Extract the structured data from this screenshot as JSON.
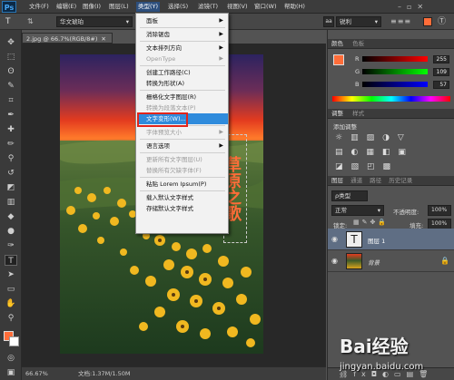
{
  "app": {
    "logo": "Ps"
  },
  "menubar": {
    "items": [
      "文件(F)",
      "编辑(E)",
      "图像(I)",
      "图层(L)",
      "类型(Y)",
      "选择(S)",
      "滤镜(T)",
      "视图(V)",
      "窗口(W)",
      "帮助(H)"
    ],
    "active_index": 4
  },
  "options": {
    "font_family": "华文琥珀",
    "aa": "锐利",
    "aa_prefix": "aa"
  },
  "document": {
    "tab": "2.jpg @ 66.7%(RGB/8#)",
    "zoom": "66.67%",
    "doc_info": "文档:1.37M/1.50M"
  },
  "canvas_text": "草原之歌",
  "type_menu": {
    "items": [
      {
        "label": "面板",
        "submenu": true,
        "enabled": true
      },
      {
        "sep": true
      },
      {
        "label": "消除锯齿",
        "submenu": true,
        "enabled": true
      },
      {
        "sep": true
      },
      {
        "label": "文本排列方向",
        "submenu": true,
        "enabled": true
      },
      {
        "label": "OpenType",
        "submenu": true,
        "enabled": false
      },
      {
        "sep": true
      },
      {
        "label": "创建工作路径(C)",
        "enabled": true
      },
      {
        "label": "转换为形状(A)",
        "enabled": true
      },
      {
        "sep": true
      },
      {
        "label": "栅格化文字图层(R)",
        "enabled": true
      },
      {
        "label": "转换为段落文本(P)",
        "enabled": false
      },
      {
        "label": "文字变形(W)...",
        "enabled": true,
        "highlighted": true
      },
      {
        "sep": true
      },
      {
        "label": "字体预览大小",
        "submenu": true,
        "enabled": false
      },
      {
        "sep": true
      },
      {
        "label": "语言选项",
        "submenu": true,
        "enabled": true
      },
      {
        "sep": true
      },
      {
        "label": "更新所有文字图层(U)",
        "enabled": false
      },
      {
        "label": "替换所有欠缺字体(F)",
        "enabled": false
      },
      {
        "sep": true
      },
      {
        "label": "粘贴 Lorem Ipsum(P)",
        "enabled": true
      },
      {
        "sep": true
      },
      {
        "label": "载入默认文字样式",
        "enabled": true
      },
      {
        "label": "存储默认文字样式",
        "enabled": true
      }
    ]
  },
  "color_panel": {
    "tabs": [
      "颜色",
      "色板"
    ],
    "channels": [
      {
        "name": "R",
        "value": "255",
        "color": "#ff0000"
      },
      {
        "name": "G",
        "value": "109",
        "color": "#00ff00"
      },
      {
        "name": "B",
        "value": "57",
        "color": "#0000ff"
      }
    ],
    "fg_color": "#ff6d39"
  },
  "adjust_panel": {
    "tabs": [
      "调整",
      "样式"
    ],
    "title": "添加调整"
  },
  "layers_panel": {
    "tabs": [
      "图层",
      "通道",
      "路径",
      "历史记录"
    ],
    "kind_label": "ρ类型",
    "blend_mode": "正常",
    "opacity_label": "不透明度:",
    "opacity": "100%",
    "lock_label": "锁定:",
    "fill_label": "填充:",
    "fill": "100%",
    "layers": [
      {
        "name": "图层 1",
        "type": "text",
        "selected": true
      },
      {
        "name": "背景",
        "type": "image",
        "selected": false
      }
    ]
  },
  "watermark": {
    "brand": "Bai经验",
    "url": "jingyan.baidu.com"
  },
  "colors": {
    "menu_bg": "#3c3c3c",
    "highlight": "#2f8bdc",
    "accent": "#e1251b",
    "text_orange": "#ff6d39"
  }
}
